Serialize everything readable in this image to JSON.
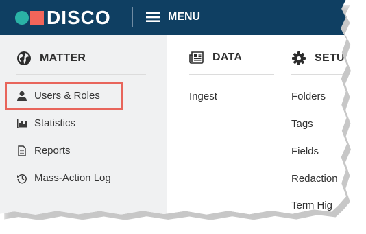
{
  "header": {
    "logo_text": "DISCO",
    "menu_label": "MENU",
    "colors": {
      "bar": "#0f3f62",
      "logo_dot": "#2ab3a6",
      "logo_square": "#f2655a"
    }
  },
  "sidebar": {
    "section_title": "MATTER",
    "section_icon": "globe-icon",
    "items": [
      {
        "label": "Users & Roles",
        "icon": "user-icon",
        "highlighted": true
      },
      {
        "label": "Statistics",
        "icon": "bar-chart-icon"
      },
      {
        "label": "Reports",
        "icon": "document-icon"
      },
      {
        "label": "Mass-Action Log",
        "icon": "history-icon"
      }
    ]
  },
  "data_column": {
    "section_title": "DATA",
    "section_icon": "newspaper-icon",
    "items": [
      {
        "label": "Ingest"
      }
    ]
  },
  "setup_column": {
    "section_title": "SETU",
    "section_icon": "gear-icon",
    "items": [
      {
        "label": "Folders"
      },
      {
        "label": "Tags"
      },
      {
        "label": "Fields"
      },
      {
        "label": "Redaction"
      },
      {
        "label": "Term Hig"
      }
    ]
  },
  "highlight_color": "#e8655b"
}
